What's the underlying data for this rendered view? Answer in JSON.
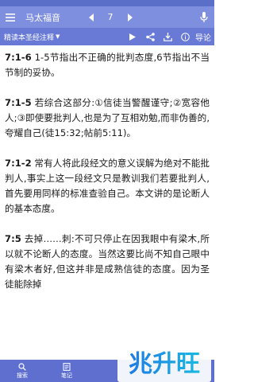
{
  "topbar": {
    "book_title": "马太福音",
    "chapter": "7"
  },
  "subbar": {
    "version_label": "精读本圣经注释",
    "guide_label": "导论"
  },
  "content": {
    "paragraphs": [
      {
        "ref": "7:1-6",
        "text": " 1-5节指出不正确的批判态度,6节指出不当节制的妥协。"
      },
      {
        "ref": "7:1-5",
        "text": " 若综合这部分:①信徒当警醒谨守;②宽容他人;③即使要批判人,也是为了互相劝勉,而非伪善的,夸耀自己(徒15:32;帖前5:11)。"
      },
      {
        "ref": "7:1-2",
        "text": " 常有人将此段经文的意义误解为绝对不能批判人,事实上这一段经文只是教训我们若要批判人,首先要用同样的标准查验自己。本文讲的是论断人的基本态度。"
      },
      {
        "ref": "7:5",
        "text": " 去掉……刺:不可只停止在因我眼中有梁木,所以就不论断人的态度。当然这要比尚不知自己眼中有梁木者好,但这并非是成熟信徒的态度。因为圣徒能除掉"
      }
    ]
  },
  "bottombar": {
    "search_label": "搜索",
    "notes_label": "笔记"
  },
  "watermark": {
    "text": "兆升旺"
  },
  "colors": {
    "topbar": "#7f8fe0",
    "subbar": "#6979d6",
    "bottombar": "#5f6fd0",
    "watermark_blue": "#1e7be6",
    "watermark_cyan": "#19b8e0"
  }
}
